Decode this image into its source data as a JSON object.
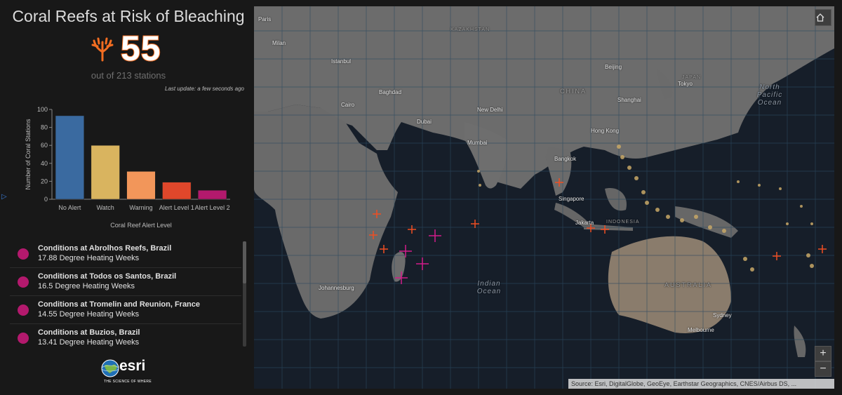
{
  "panel": {
    "title": "Coral Reefs at Risk of Bleaching",
    "big_number": "55",
    "subtitle": "out of 213 stations",
    "last_update": "Last update: a few seconds ago",
    "coral_icon": "coral-icon",
    "coral_color": "#f26d21"
  },
  "chart_data": {
    "type": "bar",
    "categories": [
      "No Alert",
      "Watch",
      "Warning",
      "Alert Level 1",
      "Alert Level 2"
    ],
    "values": [
      93,
      60,
      31,
      19,
      10
    ],
    "colors": [
      "#3a6aa0",
      "#d9b45f",
      "#f2965a",
      "#e0472b",
      "#b3196d"
    ],
    "xlabel": "Coral Reef Alert Level",
    "ylabel": "Number of Coral Stations",
    "ylim": [
      0,
      100
    ],
    "yticks": [
      0,
      20,
      40,
      60,
      80,
      100
    ],
    "grid": false
  },
  "list": {
    "items": [
      {
        "title": "Conditions at Abrolhos Reefs, Brazil",
        "sub": "17.88 Degree Heating Weeks"
      },
      {
        "title": "Conditions at Todos os Santos, Brazil",
        "sub": "16.5 Degree Heating Weeks"
      },
      {
        "title": "Conditions at Tromelin and Reunion, France",
        "sub": "14.55 Degree Heating Weeks"
      },
      {
        "title": "Conditions at Buzios, Brazil",
        "sub": "13.41 Degree Heating Weeks"
      }
    ],
    "dot_color": "#b3196d"
  },
  "logo": {
    "name": "esri",
    "tagline": "THE SCIENCE OF WHERE"
  },
  "map": {
    "home_icon": "home-icon",
    "zoom_in": "+",
    "zoom_out": "−",
    "attribution": "Source: Esri, DigitalGlobe, GeoEye, Earthstar Geographics, CNES/Airbus DS, ...",
    "labels": {
      "milan": "Milan",
      "paris": "Paris",
      "istanbul": "Istanbul",
      "baghdad": "Baghdad",
      "cairo": "Cairo",
      "dubai": "Dubai",
      "new_delhi": "New Delhi",
      "mumbai": "Mumbai",
      "beijing": "Beijing",
      "tokyo": "Tokyo",
      "shanghai": "Shanghai",
      "china": "CHINA",
      "hong_kong": "Hong Kong",
      "bangkok": "Bangkok",
      "singapore": "Singapore",
      "jakarta": "Jakarta",
      "indonesia": "INDONESIA",
      "australia": "AUSTRALIA",
      "sydney": "Sydney",
      "melbourne": "Melbourne",
      "johannesburg": "Johannesburg",
      "north_pacific": "North Pacific Ocean",
      "indian_ocean": "Indian Ocean",
      "kazakhstan": "KAZAKHSTAN",
      "japan": "JAPAN"
    }
  }
}
